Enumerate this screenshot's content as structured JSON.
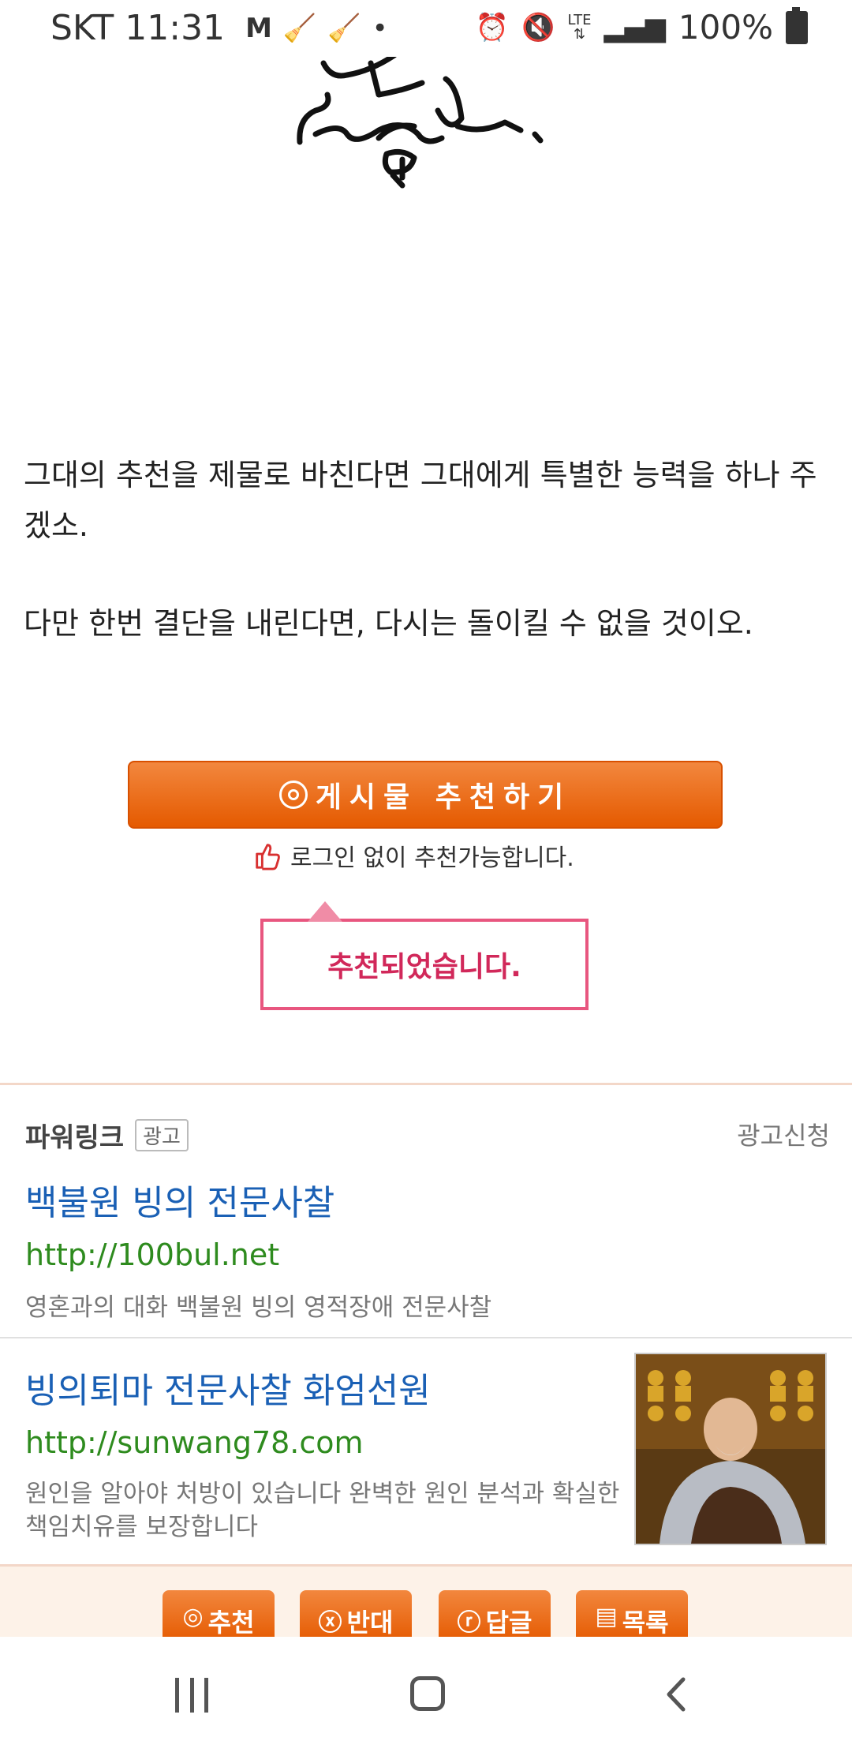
{
  "status_bar": {
    "carrier": "SKT",
    "time": "11:31",
    "mail_badge": "M",
    "network": "LTE",
    "battery": "100%"
  },
  "article": {
    "paragraph1": "그대의 추천을 제물로 바친다면 그대에게 특별한 능력을 하나 주겠소.",
    "paragraph2": "다만 한번 결단을 내린다면, 다시는 돌이킬 수 없을 것이오."
  },
  "recommend": {
    "button_label": "게시물  추천하기",
    "note": "로그인 없이 추천가능합니다.",
    "popup": "추천되었습니다."
  },
  "power_link": {
    "heading": "파워링크",
    "ad_tag": "광고",
    "apply_link": "광고신청",
    "ads": [
      {
        "title": "백불원 빙의 전문사찰",
        "url": "http://100bul.net",
        "description": "영혼과의 대화 백불원 빙의 영적장애 전문사찰"
      },
      {
        "title": "빙의퇴마 전문사찰 화엄선원",
        "url": "http://sunwang78.com",
        "description": "원인을 알아야 처방이 있습니다 완벽한 원인 분석과 확실한 책임치유를 보장합니다"
      }
    ]
  },
  "toolbar": {
    "recommend": "추천",
    "oppose": "반대",
    "reply": "답글",
    "list": "목록"
  },
  "colors": {
    "accent_orange": "#e55a00",
    "popup_pink": "#e8567f",
    "link_blue": "#1a60b5",
    "url_green": "#2e8b1e"
  }
}
